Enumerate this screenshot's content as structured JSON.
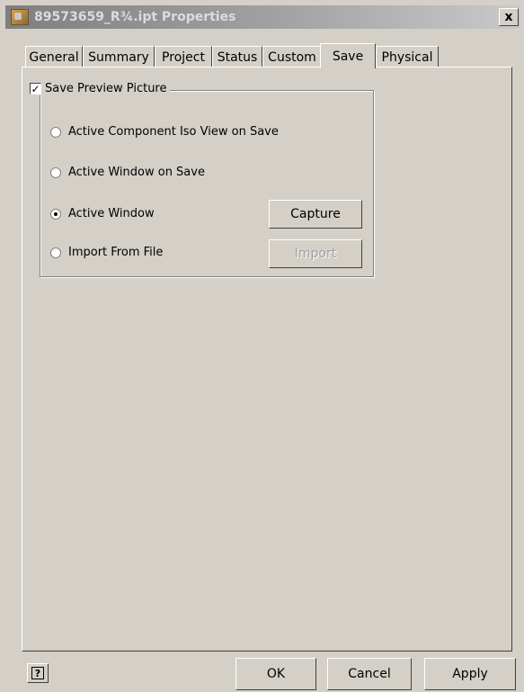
{
  "window": {
    "title": "89573659_R¾.ipt Properties",
    "close_label": "x"
  },
  "tabs": [
    {
      "label": "General",
      "active": false
    },
    {
      "label": "Summary",
      "active": false
    },
    {
      "label": "Project",
      "active": false
    },
    {
      "label": "Status",
      "active": false
    },
    {
      "label": "Custom",
      "active": false
    },
    {
      "label": "Save",
      "active": true
    },
    {
      "label": "Physical",
      "active": false
    }
  ],
  "save_tab": {
    "save_preview": {
      "label": "Save Preview Picture",
      "checked": true,
      "mark": "✓"
    },
    "options": [
      {
        "label": "Active Component Iso View on Save",
        "selected": false
      },
      {
        "label": "Active Window on Save",
        "selected": false
      },
      {
        "label": "Active Window",
        "selected": true
      },
      {
        "label": "Import From File",
        "selected": false
      }
    ],
    "capture_label": "Capture",
    "import_label": "Import"
  },
  "footer": {
    "help_label": "?",
    "ok_label": "OK",
    "cancel_label": "Cancel",
    "apply_label": "Apply"
  }
}
